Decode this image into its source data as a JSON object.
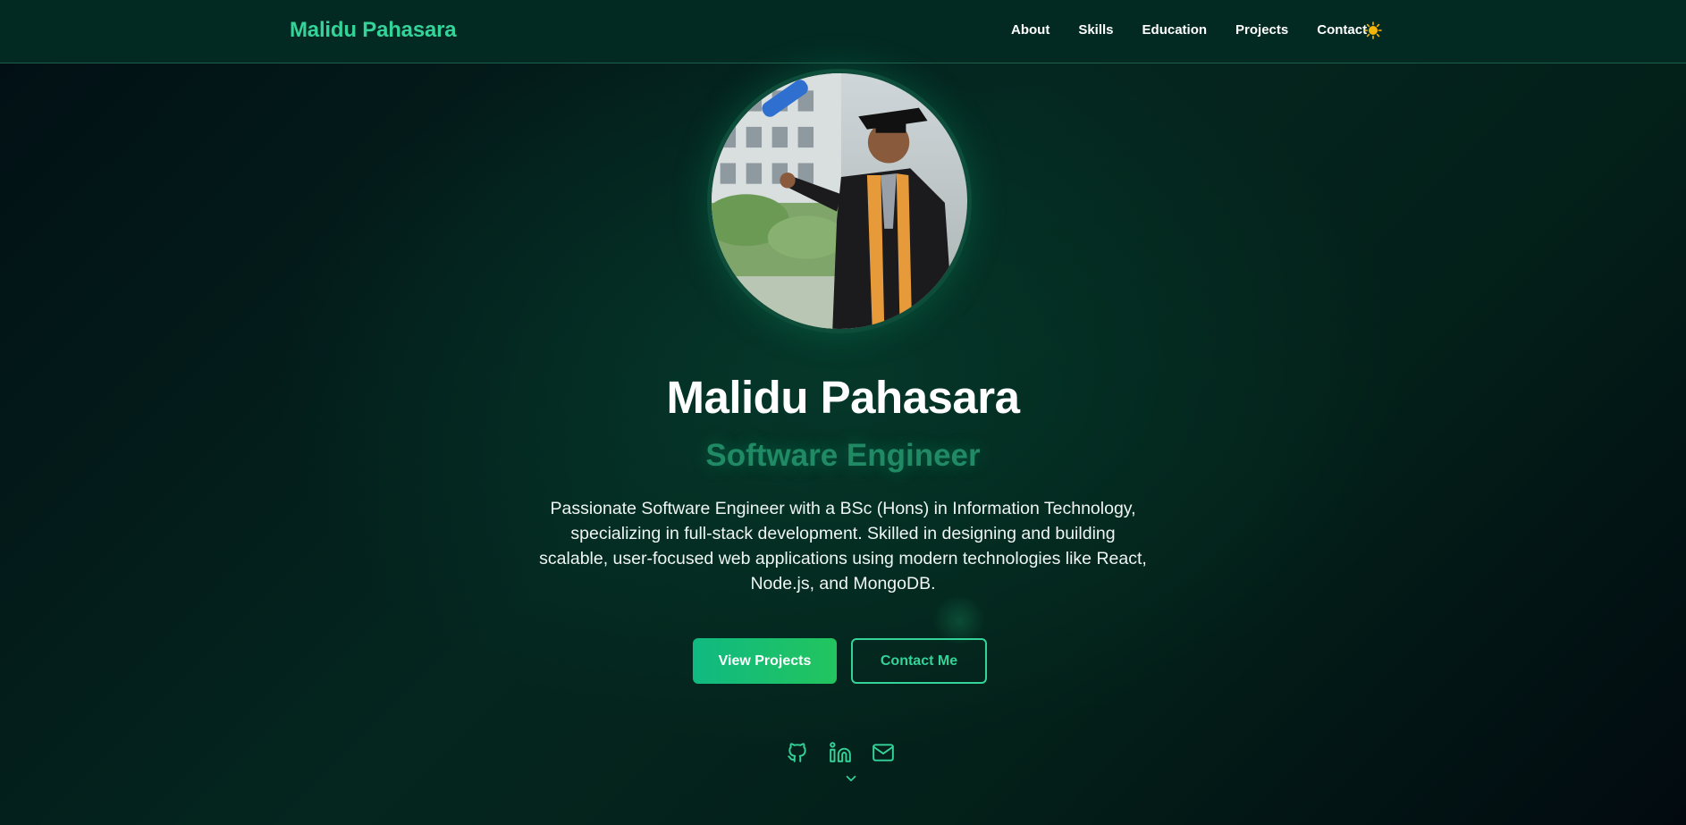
{
  "nav": {
    "brand": "Malidu Pahasara",
    "links": [
      "About",
      "Skills",
      "Education",
      "Projects",
      "Contact"
    ],
    "theme_icon": "sun-icon"
  },
  "hero": {
    "name": "Malidu Pahasara",
    "role": "Software Engineer",
    "description": "Passionate Software Engineer with a BSc (Hons) in Information Technology, specializing in full-stack development. Skilled in designing and building scalable, user-focused web applications using modern technologies like React, Node.js, and MongoDB.",
    "primary_button": "View Projects",
    "secondary_button": "Contact Me"
  },
  "social": {
    "icons": [
      "github-icon",
      "linkedin-icon",
      "mail-icon"
    ],
    "scroll_icon": "chevron-down-icon"
  },
  "colors": {
    "accent": "#34d399",
    "accent_dark": "#10b981",
    "nav_bg": "#032a22",
    "role_text": "#1f8a64",
    "sun": "#f5b40a"
  }
}
